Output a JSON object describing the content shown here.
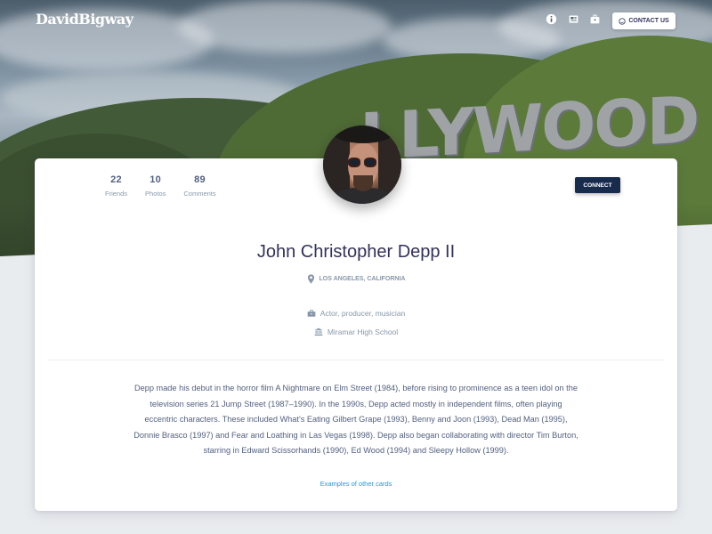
{
  "brand": "DavidBigway",
  "nav": {
    "contact_label": "CONTACT US"
  },
  "profile": {
    "stats": [
      {
        "value": "22",
        "label": "Friends"
      },
      {
        "value": "10",
        "label": "Photos"
      },
      {
        "value": "89",
        "label": "Comments"
      }
    ],
    "connect_label": "CONNECT",
    "name": "John Christopher Depp II",
    "location": "LOS ANGELES, CALIFORNIA",
    "occupation": "Actor, producer, musician",
    "education": "Miramar High School",
    "bio": "Depp made his debut in the horror film A Nightmare on Elm Street (1984), before rising to prominence as a teen idol on the television series 21 Jump Street (1987–1990). In the 1990s, Depp acted mostly in independent films, often playing eccentric characters. These included What's Eating Gilbert Grape (1993), Benny and Joon (1993), Dead Man (1995), Donnie Brasco (1997) and Fear and Loathing in Las Vegas (1998). Depp also began collaborating with director Tim Burton, starring in Edward Scissorhands (1990), Ed Wood (1994) and Sleepy Hollow (1999).",
    "more_link": "Examples of other cards"
  },
  "hero_sign": "LLYWOOD",
  "colors": {
    "primary_dark": "#172b4d",
    "heading": "#32325d",
    "muted": "#8898aa",
    "link": "#1f9be8"
  },
  "icons": [
    "info-icon",
    "newspaper-icon",
    "briefcase-icon",
    "smiley-icon",
    "location-pin-icon",
    "briefcase-icon",
    "university-icon"
  ]
}
